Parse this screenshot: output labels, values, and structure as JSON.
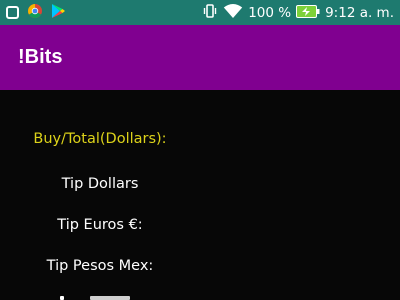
{
  "status_bar": {
    "battery_percent": "100 %",
    "time": "9:12 a. m.",
    "left_icons": [
      "status-square-icon",
      "chrome-icon",
      "play-store-icon"
    ],
    "right_icons": [
      "vibrate-icon",
      "wifi-icon",
      "battery-charging-icon"
    ]
  },
  "app_bar": {
    "title": "!Bits",
    "color": "#800090"
  },
  "content": {
    "buy_total_label": "Buy/Total(Dollars):",
    "tip_dollars_label": "Tip Dollars",
    "tip_euros_label": "Tip Euros €:",
    "tip_pesos_label": "Tip Pesos Mex:",
    "accent_color": "#dcd21a"
  }
}
